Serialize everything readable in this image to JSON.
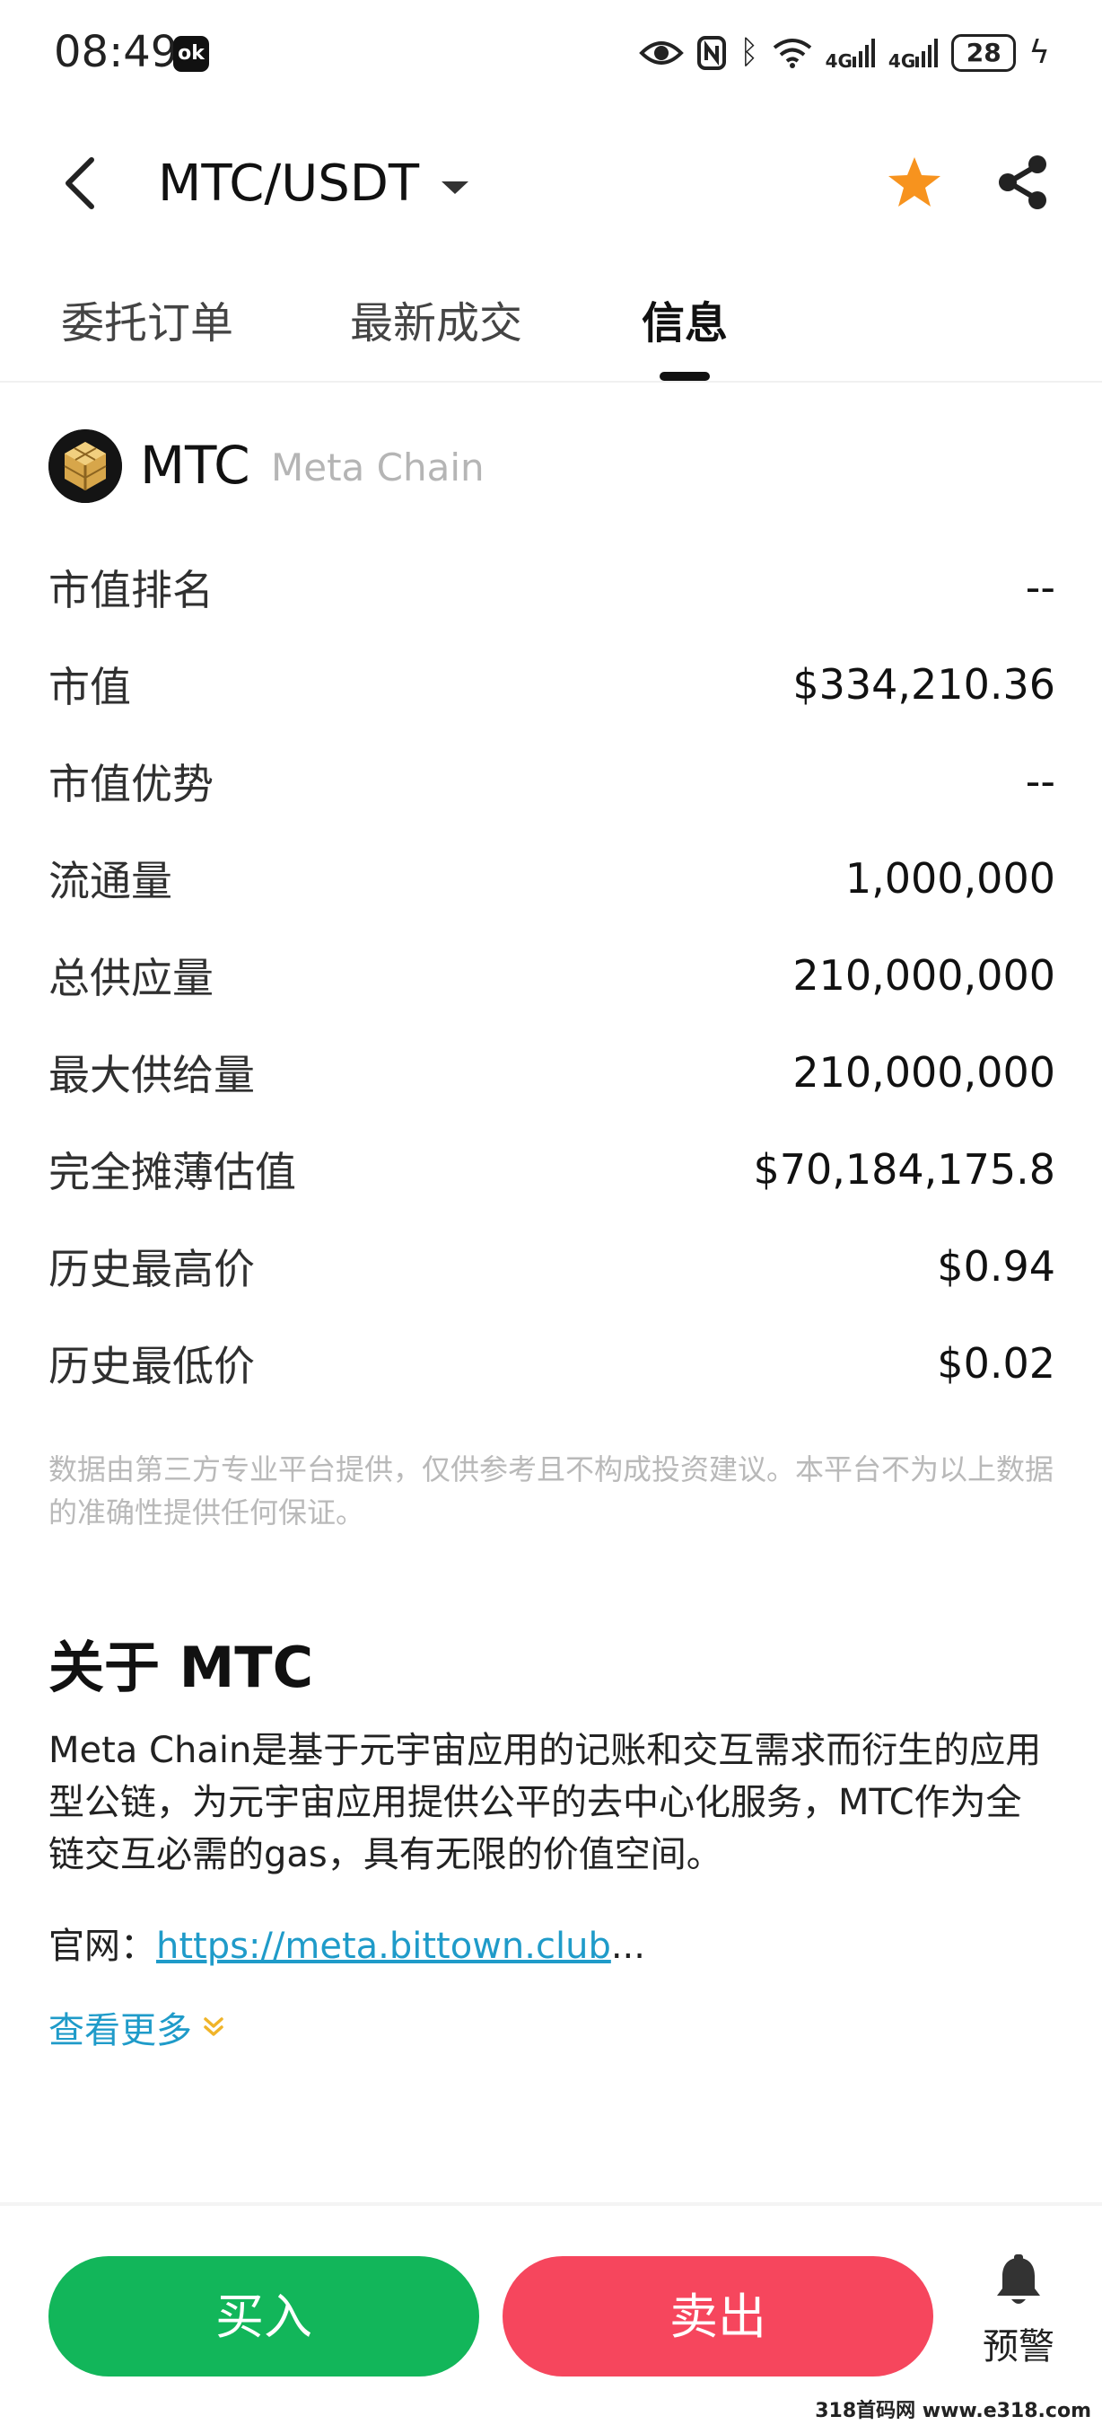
{
  "status_bar": {
    "time": "08:49",
    "app_badge": "ok",
    "network_1": "4G",
    "network_2": "4G",
    "battery": "28"
  },
  "header": {
    "pair": "MTC/USDT"
  },
  "tabs": [
    {
      "label": "委托订单",
      "active": false
    },
    {
      "label": "最新成交",
      "active": false
    },
    {
      "label": "信息",
      "active": true
    }
  ],
  "coin": {
    "symbol": "MTC",
    "name": "Meta Chain"
  },
  "info_rows": [
    {
      "label": "市值排名",
      "value": "--"
    },
    {
      "label": "市值",
      "value": "$334,210.36"
    },
    {
      "label": "市值优势",
      "value": "--"
    },
    {
      "label": "流通量",
      "value": "1,000,000"
    },
    {
      "label": "总供应量",
      "value": "210,000,000"
    },
    {
      "label": "最大供给量",
      "value": "210,000,000"
    },
    {
      "label": "完全摊薄估值",
      "value": "$70,184,175.8"
    },
    {
      "label": "历史最高价",
      "value": "$0.94"
    },
    {
      "label": "历史最低价",
      "value": "$0.02"
    }
  ],
  "disclaimer": "数据由第三方专业平台提供，仅供参考且不构成投资建议。本平台不为以上数据的准确性提供任何保证。",
  "about": {
    "title": "关于 MTC",
    "description": "Meta Chain是基于元宇宙应用的记账和交互需求而衍生的应用型公链，为元宇宙应用提供公平的去中心化服务，MTC作为全链交互必需的gas，具有无限的价值空间。",
    "website_label": "官网：",
    "website_url": "https://meta.bittown.club",
    "website_ellipsis": "...",
    "more_label": "查看更多"
  },
  "actions": {
    "buy_label": "买入",
    "sell_label": "卖出",
    "alert_label": "预警"
  },
  "watermark": "318首码网 www.e318.com",
  "colors": {
    "buy": "#12b65a",
    "sell": "#f6465d",
    "star": "#f7931e",
    "link": "#1f9bc9"
  }
}
